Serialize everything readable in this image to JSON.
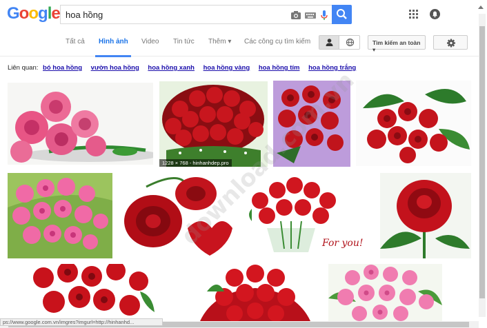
{
  "logo": {
    "letters": [
      "G",
      "o",
      "o",
      "g",
      "l",
      "e"
    ],
    "colors": [
      "#4285f4",
      "#ea4335",
      "#fbbc05",
      "#4285f4",
      "#34a853",
      "#ea4335"
    ]
  },
  "search": {
    "query": "hoa hồng",
    "camera_icon": "camera-icon",
    "keyboard_icon": "keyboard-icon",
    "mic_icon": "mic-icon",
    "button_icon": "search-icon"
  },
  "header": {
    "apps_icon": "apps-grid-icon",
    "notifications_icon": "notifications-icon"
  },
  "tabs": [
    "Tất cả",
    "Hình ảnh",
    "Video",
    "Tin tức",
    "Thêm ▾",
    "Các công cụ tìm kiếm"
  ],
  "active_tab": "Hình ảnh",
  "safe_search": "Tìm kiếm an toàn ▾",
  "related": {
    "label": "Liên quan:",
    "items": [
      "bó hoa hồng",
      "vườn hoa hồng",
      "hoa hồng xanh",
      "hoa hồng vàng",
      "hoa hồng tím",
      "hoa hồng trắng"
    ]
  },
  "results": {
    "caption": "1228 × 768 - hinhanhdep.pro",
    "card_text": "For you!"
  },
  "watermark": "download.com.vn",
  "status_url": "ps://www.google.com.vn/imgres?imgurl=http://hinhanhd...",
  "colors": {
    "accent": "#4285f4",
    "link": "#1a0dab"
  }
}
